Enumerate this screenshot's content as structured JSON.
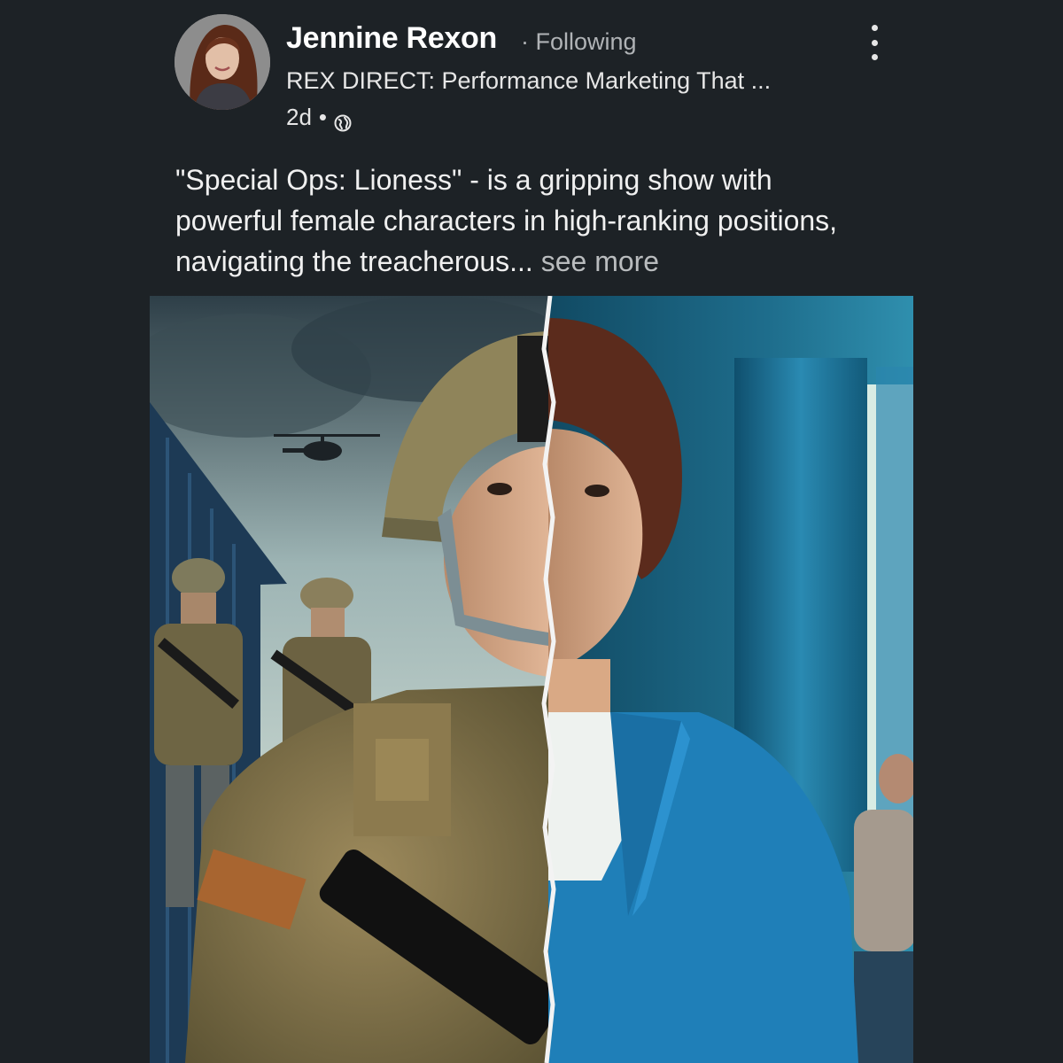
{
  "post": {
    "author": {
      "name": "Jennine Rexon",
      "follow_status": "Following",
      "headline": "REX DIRECT: Performance Marketing That ...",
      "timestamp": "2d",
      "visibility_icon": "globe-icon"
    },
    "menu_icon": "more-vertical-icon",
    "text": "\"Special Ops: Lioness\" - is a gripping show with powerful female characters in high-ranking positions, navigating the treacherous...",
    "see_more_label": "see more",
    "image": {
      "alt_subject": "split portrait: soldier in camouflage and woman in blue cardigan"
    }
  },
  "colors": {
    "background": "#1d2226",
    "name_text": "#ffffff",
    "secondary_text": "#b0b3b6",
    "body_text": "#f0f0f0"
  }
}
